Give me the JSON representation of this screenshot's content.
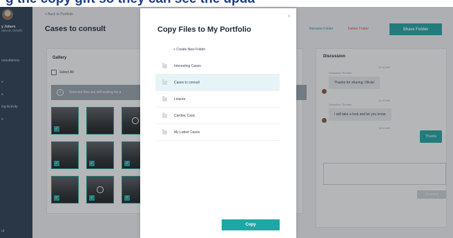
{
  "banner": {
    "text": "g the copy gift so they can see the upda"
  },
  "sidebar": {
    "user_name": "y Jobers",
    "user_sub": "atients details",
    "items": [
      {
        "label": "onsultations"
      },
      {
        "label": "s"
      },
      {
        "label": "s"
      },
      {
        "label": "ing Activity"
      },
      {
        "label": "s"
      },
      {
        "label": "ut"
      }
    ]
  },
  "main": {
    "back_link": "< Back to Portfolio",
    "title": "Cases to consult",
    "rename_label": "Rename Folder",
    "delete_label": "Delete Folder",
    "share_label": "Share Folder",
    "gallery_title": "Gallery",
    "select_all_label": "Select All",
    "info_text": "Selected files are still waiting for a",
    "thumbs": [
      {
        "check": "✓"
      },
      {
        "check": ""
      },
      {
        "check": ""
      },
      {
        "check": "✓"
      },
      {
        "check": "✓"
      },
      {
        "check": "✓"
      },
      {
        "check": "✓"
      },
      {
        "check": "✓"
      },
      {
        "check": "✓"
      }
    ]
  },
  "discussion": {
    "title": "Discussion",
    "messages": [
      {
        "time": "11:00 AM",
        "sender": "Sebastien Thomas",
        "text": "Thanks for sharing, Olivia!"
      },
      {
        "time": "11:00 AM",
        "sender": "Sebastien Thomas",
        "text": "I will take a look and let you know."
      },
      {
        "time": "11:00 AM",
        "text": "Thanks"
      }
    ],
    "send_label": "Connect"
  },
  "modal": {
    "title": "Copy Files to My Portfolio",
    "create_label": "+ Create New Folder",
    "folders": [
      {
        "label": "Interesting Cases",
        "selected": false
      },
      {
        "label": "Cases to consult",
        "selected": true
      },
      {
        "label": "Leisure",
        "selected": false
      },
      {
        "label": "Cardiac Case",
        "selected": false
      },
      {
        "label": "My Latest Cases",
        "selected": false
      }
    ],
    "copy_label": "Copy",
    "close_symbol": "×"
  }
}
